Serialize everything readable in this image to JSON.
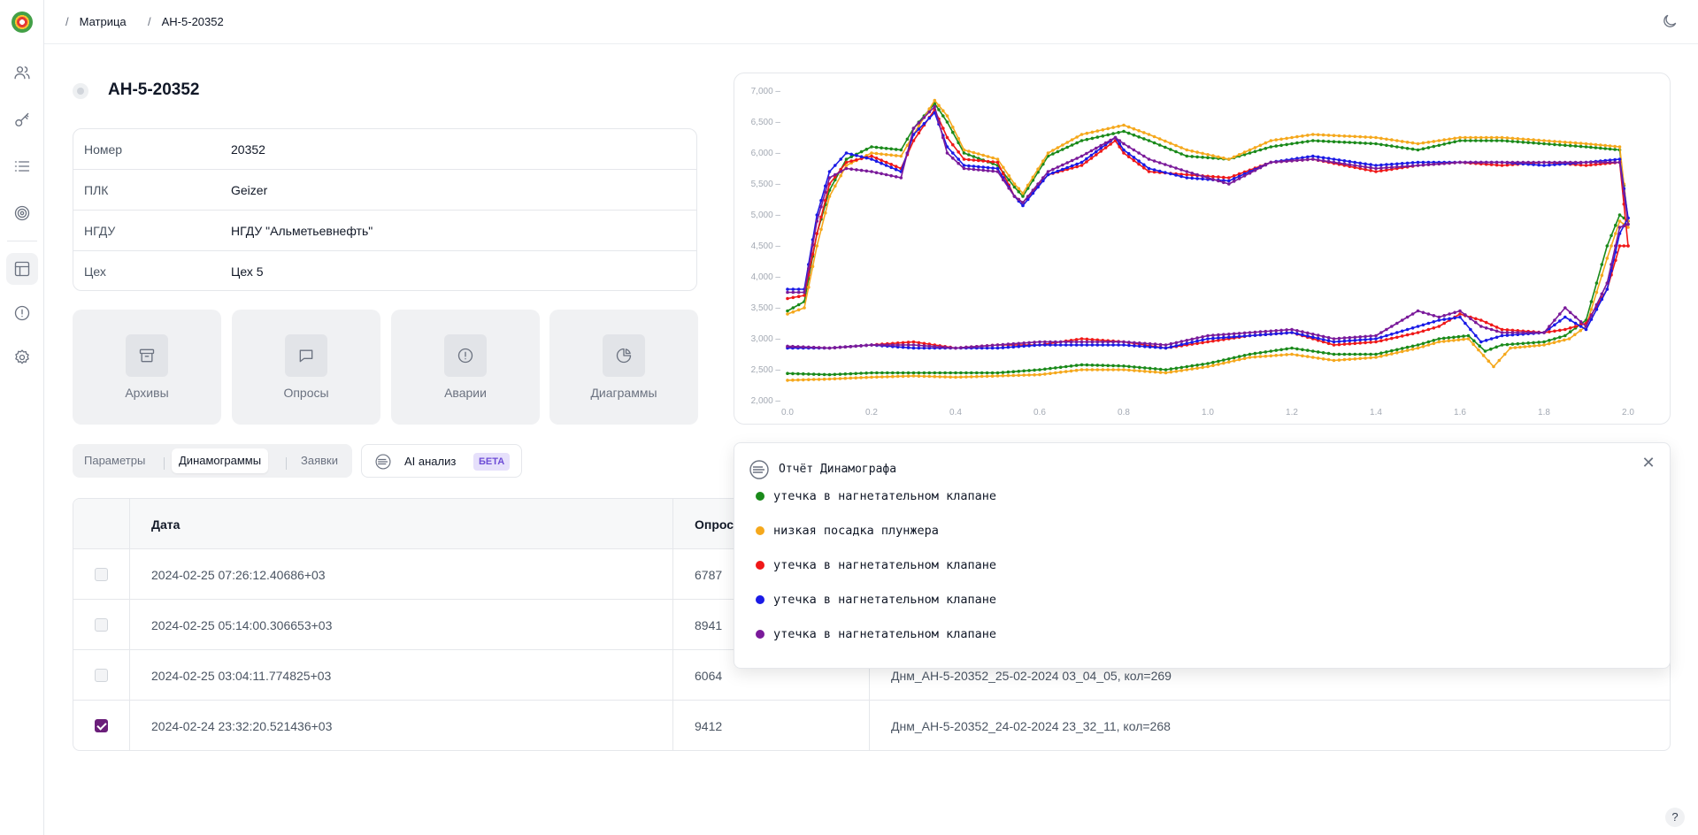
{
  "breadcrumb": {
    "items": [
      "Матрица",
      "АН-5-20352"
    ]
  },
  "title": "АН-5-20352",
  "info": [
    {
      "key": "Номер",
      "value": "20352"
    },
    {
      "key": "ПЛК",
      "value": "Geizer"
    },
    {
      "key": "НГДУ",
      "value": "НГДУ \"Альметьевнефть\""
    },
    {
      "key": "Цех",
      "value": "Цех 5"
    }
  ],
  "tiles": [
    "Архивы",
    "Опросы",
    "Аварии",
    "Диаграммы"
  ],
  "tabs": [
    "Параметры",
    "Динамограммы",
    "Заявки"
  ],
  "ai_button": {
    "label": "AI анализ",
    "badge": "БЕТА"
  },
  "table": {
    "headers": [
      "Дата",
      "Опрос",
      ""
    ],
    "rows": [
      {
        "date": "2024-02-25 07:26:12.40686+03",
        "poll": "6787",
        "file": "",
        "checked": false
      },
      {
        "date": "2024-02-25 05:14:00.306653+03",
        "poll": "8941",
        "file": "",
        "checked": false
      },
      {
        "date": "2024-02-25 03:04:11.774825+03",
        "poll": "6064",
        "file": "Днм_АН-5-20352_25-02-2024 03_04_05, кол=269",
        "checked": false
      },
      {
        "date": "2024-02-24 23:32:20.521436+03",
        "poll": "9412",
        "file": "Днм_АН-5-20352_24-02-2024 23_32_11, кол=268",
        "checked": true
      }
    ]
  },
  "report": {
    "title": "Отчёт Динамографа",
    "items": [
      {
        "label": "утечка в нагнетательном клапане",
        "color": "#1a8a1a"
      },
      {
        "label": "низкая посадка плунжера",
        "color": "#f5a81c"
      },
      {
        "label": "утечка в нагнетательном клапане",
        "color": "#f01818"
      },
      {
        "label": "утечка в нагнетательном клапане",
        "color": "#1a1ae6"
      },
      {
        "label": "утечка в нагнетательном клапане",
        "color": "#7a1a9a"
      }
    ]
  },
  "chart_data": {
    "type": "line",
    "xlim": [
      0,
      2.0
    ],
    "ylim": [
      2000,
      7000
    ],
    "x_ticks": [
      "0.0",
      "0.2",
      "0.4",
      "0.6",
      "0.8",
      "1.0",
      "1.2",
      "1.4",
      "1.6",
      "1.8",
      "2.0"
    ],
    "y_ticks": [
      "2,000",
      "2,500",
      "3,000",
      "3,500",
      "4,000",
      "4,500",
      "5,000",
      "5,500",
      "6,000",
      "6,500",
      "7,000"
    ],
    "series": [
      {
        "color": "#1a8a1a",
        "upper": [
          [
            0,
            3450
          ],
          [
            0.04,
            3600
          ],
          [
            0.07,
            4700
          ],
          [
            0.1,
            5400
          ],
          [
            0.14,
            5900
          ],
          [
            0.2,
            6100
          ],
          [
            0.27,
            6050
          ],
          [
            0.3,
            6400
          ],
          [
            0.35,
            6800
          ],
          [
            0.38,
            6500
          ],
          [
            0.42,
            6000
          ],
          [
            0.5,
            5800
          ],
          [
            0.54,
            5450
          ],
          [
            0.56,
            5300
          ],
          [
            0.62,
            5950
          ],
          [
            0.7,
            6200
          ],
          [
            0.8,
            6350
          ],
          [
            0.86,
            6200
          ],
          [
            0.95,
            5950
          ],
          [
            1.05,
            5900
          ],
          [
            1.15,
            6100
          ],
          [
            1.25,
            6200
          ],
          [
            1.4,
            6150
          ],
          [
            1.5,
            6050
          ],
          [
            1.6,
            6200
          ],
          [
            1.7,
            6200
          ],
          [
            1.8,
            6150
          ],
          [
            1.9,
            6100
          ],
          [
            1.98,
            6050
          ],
          [
            2.0,
            4900
          ]
        ],
        "lower": [
          [
            0,
            2440
          ],
          [
            0.1,
            2420
          ],
          [
            0.2,
            2450
          ],
          [
            0.3,
            2450
          ],
          [
            0.4,
            2450
          ],
          [
            0.5,
            2450
          ],
          [
            0.6,
            2500
          ],
          [
            0.7,
            2580
          ],
          [
            0.8,
            2560
          ],
          [
            0.9,
            2500
          ],
          [
            1.0,
            2600
          ],
          [
            1.1,
            2750
          ],
          [
            1.2,
            2850
          ],
          [
            1.3,
            2750
          ],
          [
            1.4,
            2750
          ],
          [
            1.5,
            2900
          ],
          [
            1.55,
            3000
          ],
          [
            1.62,
            3050
          ],
          [
            1.66,
            2800
          ],
          [
            1.7,
            2900
          ],
          [
            1.8,
            2950
          ],
          [
            1.85,
            3050
          ],
          [
            1.9,
            3300
          ],
          [
            1.95,
            4500
          ],
          [
            1.98,
            5000
          ],
          [
            2.0,
            4900
          ]
        ]
      },
      {
        "color": "#f5a81c",
        "upper": [
          [
            0,
            3400
          ],
          [
            0.04,
            3500
          ],
          [
            0.07,
            4500
          ],
          [
            0.1,
            5300
          ],
          [
            0.14,
            5800
          ],
          [
            0.2,
            6000
          ],
          [
            0.27,
            5950
          ],
          [
            0.3,
            6300
          ],
          [
            0.35,
            6850
          ],
          [
            0.38,
            6600
          ],
          [
            0.42,
            6050
          ],
          [
            0.5,
            5900
          ],
          [
            0.54,
            5500
          ],
          [
            0.56,
            5350
          ],
          [
            0.62,
            6000
          ],
          [
            0.7,
            6300
          ],
          [
            0.8,
            6450
          ],
          [
            0.86,
            6300
          ],
          [
            0.95,
            6050
          ],
          [
            1.05,
            5900
          ],
          [
            1.15,
            6200
          ],
          [
            1.25,
            6300
          ],
          [
            1.4,
            6250
          ],
          [
            1.5,
            6150
          ],
          [
            1.6,
            6250
          ],
          [
            1.7,
            6250
          ],
          [
            1.8,
            6200
          ],
          [
            1.9,
            6150
          ],
          [
            1.98,
            6100
          ],
          [
            2.0,
            4900
          ]
        ],
        "lower": [
          [
            0,
            2330
          ],
          [
            0.1,
            2350
          ],
          [
            0.2,
            2380
          ],
          [
            0.3,
            2400
          ],
          [
            0.4,
            2380
          ],
          [
            0.5,
            2400
          ],
          [
            0.6,
            2420
          ],
          [
            0.7,
            2500
          ],
          [
            0.8,
            2500
          ],
          [
            0.9,
            2450
          ],
          [
            1.0,
            2550
          ],
          [
            1.1,
            2700
          ],
          [
            1.2,
            2750
          ],
          [
            1.3,
            2650
          ],
          [
            1.4,
            2700
          ],
          [
            1.5,
            2850
          ],
          [
            1.55,
            2950
          ],
          [
            1.62,
            3000
          ],
          [
            1.68,
            2550
          ],
          [
            1.72,
            2850
          ],
          [
            1.8,
            2900
          ],
          [
            1.86,
            3000
          ],
          [
            1.9,
            3200
          ],
          [
            1.95,
            4300
          ],
          [
            1.98,
            4900
          ],
          [
            2.0,
            4800
          ]
        ]
      },
      {
        "color": "#f01818",
        "upper": [
          [
            0,
            3650
          ],
          [
            0.04,
            3700
          ],
          [
            0.07,
            4700
          ],
          [
            0.1,
            5500
          ],
          [
            0.14,
            5850
          ],
          [
            0.2,
            5950
          ],
          [
            0.27,
            5750
          ],
          [
            0.3,
            6200
          ],
          [
            0.35,
            6700
          ],
          [
            0.38,
            6250
          ],
          [
            0.42,
            5900
          ],
          [
            0.5,
            5850
          ],
          [
            0.54,
            5300
          ],
          [
            0.56,
            5200
          ],
          [
            0.62,
            5650
          ],
          [
            0.7,
            5800
          ],
          [
            0.78,
            6200
          ],
          [
            0.8,
            6000
          ],
          [
            0.86,
            5700
          ],
          [
            0.95,
            5650
          ],
          [
            1.05,
            5600
          ],
          [
            1.15,
            5850
          ],
          [
            1.25,
            5900
          ],
          [
            1.4,
            5700
          ],
          [
            1.5,
            5800
          ],
          [
            1.6,
            5850
          ],
          [
            1.7,
            5800
          ],
          [
            1.8,
            5850
          ],
          [
            1.9,
            5800
          ],
          [
            1.98,
            5850
          ],
          [
            2.0,
            4500
          ]
        ],
        "lower": [
          [
            0,
            2870
          ],
          [
            0.1,
            2850
          ],
          [
            0.2,
            2900
          ],
          [
            0.3,
            2950
          ],
          [
            0.4,
            2850
          ],
          [
            0.5,
            2900
          ],
          [
            0.6,
            2900
          ],
          [
            0.7,
            3000
          ],
          [
            0.8,
            2950
          ],
          [
            0.9,
            2850
          ],
          [
            1.0,
            2950
          ],
          [
            1.1,
            3050
          ],
          [
            1.2,
            3100
          ],
          [
            1.3,
            2900
          ],
          [
            1.4,
            2950
          ],
          [
            1.5,
            3100
          ],
          [
            1.55,
            3200
          ],
          [
            1.6,
            3400
          ],
          [
            1.65,
            3300
          ],
          [
            1.7,
            3150
          ],
          [
            1.8,
            3100
          ],
          [
            1.85,
            3150
          ],
          [
            1.9,
            3250
          ],
          [
            1.95,
            3800
          ],
          [
            1.98,
            4500
          ],
          [
            2.0,
            4500
          ]
        ]
      },
      {
        "color": "#1a1ae6",
        "upper": [
          [
            0,
            3800
          ],
          [
            0.04,
            3800
          ],
          [
            0.07,
            5000
          ],
          [
            0.1,
            5700
          ],
          [
            0.14,
            6000
          ],
          [
            0.2,
            5900
          ],
          [
            0.27,
            5700
          ],
          [
            0.3,
            6300
          ],
          [
            0.35,
            6650
          ],
          [
            0.38,
            6100
          ],
          [
            0.42,
            5800
          ],
          [
            0.5,
            5750
          ],
          [
            0.54,
            5300
          ],
          [
            0.56,
            5150
          ],
          [
            0.62,
            5650
          ],
          [
            0.7,
            5850
          ],
          [
            0.78,
            6250
          ],
          [
            0.8,
            6050
          ],
          [
            0.86,
            5750
          ],
          [
            0.95,
            5600
          ],
          [
            1.05,
            5550
          ],
          [
            1.15,
            5850
          ],
          [
            1.25,
            5950
          ],
          [
            1.4,
            5800
          ],
          [
            1.5,
            5850
          ],
          [
            1.6,
            5850
          ],
          [
            1.7,
            5850
          ],
          [
            1.8,
            5800
          ],
          [
            1.9,
            5850
          ],
          [
            1.98,
            5900
          ],
          [
            2.0,
            4950
          ]
        ],
        "lower": [
          [
            0,
            2850
          ],
          [
            0.1,
            2850
          ],
          [
            0.2,
            2900
          ],
          [
            0.3,
            2850
          ],
          [
            0.4,
            2850
          ],
          [
            0.5,
            2850
          ],
          [
            0.6,
            2900
          ],
          [
            0.7,
            2900
          ],
          [
            0.8,
            2900
          ],
          [
            0.9,
            2850
          ],
          [
            1.0,
            3000
          ],
          [
            1.1,
            3050
          ],
          [
            1.2,
            3100
          ],
          [
            1.3,
            2950
          ],
          [
            1.4,
            3000
          ],
          [
            1.5,
            3200
          ],
          [
            1.55,
            3300
          ],
          [
            1.6,
            3350
          ],
          [
            1.65,
            2950
          ],
          [
            1.7,
            3050
          ],
          [
            1.8,
            3100
          ],
          [
            1.85,
            3350
          ],
          [
            1.9,
            3150
          ],
          [
            1.95,
            3800
          ],
          [
            1.98,
            4700
          ],
          [
            2.0,
            4950
          ]
        ]
      },
      {
        "color": "#7a1a9a",
        "upper": [
          [
            0,
            3750
          ],
          [
            0.04,
            3750
          ],
          [
            0.07,
            4900
          ],
          [
            0.1,
            5600
          ],
          [
            0.14,
            5750
          ],
          [
            0.2,
            5700
          ],
          [
            0.27,
            5600
          ],
          [
            0.3,
            6400
          ],
          [
            0.35,
            6750
          ],
          [
            0.38,
            6000
          ],
          [
            0.42,
            5750
          ],
          [
            0.5,
            5700
          ],
          [
            0.54,
            5300
          ],
          [
            0.56,
            5200
          ],
          [
            0.62,
            5700
          ],
          [
            0.7,
            5950
          ],
          [
            0.78,
            6250
          ],
          [
            0.8,
            6150
          ],
          [
            0.86,
            5900
          ],
          [
            0.95,
            5700
          ],
          [
            1.05,
            5500
          ],
          [
            1.15,
            5850
          ],
          [
            1.25,
            5900
          ],
          [
            1.4,
            5750
          ],
          [
            1.5,
            5800
          ],
          [
            1.6,
            5850
          ],
          [
            1.7,
            5850
          ],
          [
            1.8,
            5850
          ],
          [
            1.9,
            5850
          ],
          [
            1.98,
            5850
          ],
          [
            2.0,
            4850
          ]
        ],
        "lower": [
          [
            0,
            2880
          ],
          [
            0.1,
            2850
          ],
          [
            0.2,
            2900
          ],
          [
            0.3,
            2900
          ],
          [
            0.4,
            2850
          ],
          [
            0.5,
            2900
          ],
          [
            0.6,
            2950
          ],
          [
            0.7,
            2950
          ],
          [
            0.8,
            2950
          ],
          [
            0.9,
            2900
          ],
          [
            1.0,
            3050
          ],
          [
            1.1,
            3100
          ],
          [
            1.2,
            3150
          ],
          [
            1.3,
            3000
          ],
          [
            1.4,
            3050
          ],
          [
            1.5,
            3450
          ],
          [
            1.55,
            3350
          ],
          [
            1.6,
            3450
          ],
          [
            1.65,
            3200
          ],
          [
            1.7,
            3100
          ],
          [
            1.8,
            3100
          ],
          [
            1.85,
            3500
          ],
          [
            1.9,
            3200
          ],
          [
            1.95,
            3900
          ],
          [
            1.98,
            4800
          ],
          [
            2.0,
            4850
          ]
        ]
      }
    ]
  }
}
